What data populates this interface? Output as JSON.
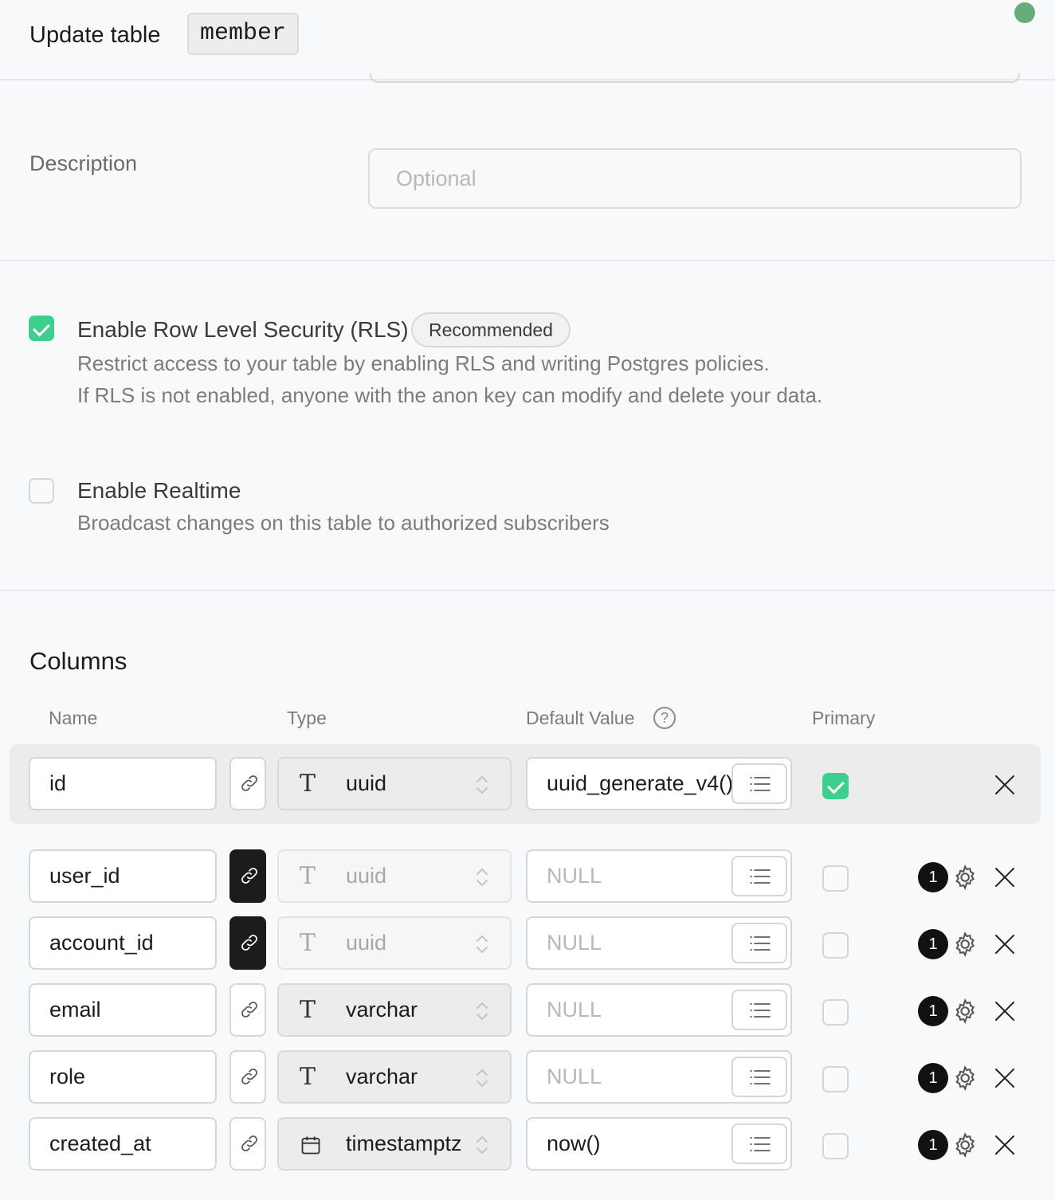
{
  "header": {
    "title": "Update table",
    "table_name": "member"
  },
  "description": {
    "label": "Description",
    "placeholder": "Optional"
  },
  "rls": {
    "checked": true,
    "title": "Enable Row Level Security (RLS)",
    "badge": "Recommended",
    "desc_line1": "Restrict access to your table by enabling RLS and writing Postgres policies.",
    "desc_line2": "If RLS is not enabled, anyone with the anon key can modify and delete your data."
  },
  "realtime": {
    "checked": false,
    "title": "Enable Realtime",
    "desc": "Broadcast changes on this table to authorized subscribers"
  },
  "columns": {
    "title": "Columns",
    "headers": {
      "name": "Name",
      "type": "Type",
      "default": "Default Value",
      "primary": "Primary",
      "help": "?"
    },
    "rows": [
      {
        "name": "id",
        "link_active": false,
        "type": "uuid",
        "type_icon": "text-type-icon",
        "type_disabled": false,
        "default": "uuid_generate_v4()",
        "default_is_null": false,
        "primary": true,
        "policy_count": null
      },
      {
        "name": "user_id",
        "link_active": true,
        "type": "uuid",
        "type_icon": "text-type-icon",
        "type_disabled": true,
        "default": "NULL",
        "default_is_null": true,
        "primary": false,
        "policy_count": "1"
      },
      {
        "name": "account_id",
        "link_active": true,
        "type": "uuid",
        "type_icon": "text-type-icon",
        "type_disabled": true,
        "default": "NULL",
        "default_is_null": true,
        "primary": false,
        "policy_count": "1"
      },
      {
        "name": "email",
        "link_active": false,
        "type": "varchar",
        "type_icon": "text-type-icon",
        "type_disabled": false,
        "default": "NULL",
        "default_is_null": true,
        "primary": false,
        "policy_count": "1"
      },
      {
        "name": "role",
        "link_active": false,
        "type": "varchar",
        "type_icon": "text-type-icon",
        "type_disabled": false,
        "default": "NULL",
        "default_is_null": true,
        "primary": false,
        "policy_count": "1"
      },
      {
        "name": "created_at",
        "link_active": false,
        "type": "timestamptz",
        "type_icon": "calendar-icon",
        "type_disabled": false,
        "default": "now()",
        "default_is_null": false,
        "primary": false,
        "policy_count": "1"
      }
    ]
  },
  "colors": {
    "accent_green": "#3ecf8e",
    "status_dot": "#65ad7a"
  }
}
